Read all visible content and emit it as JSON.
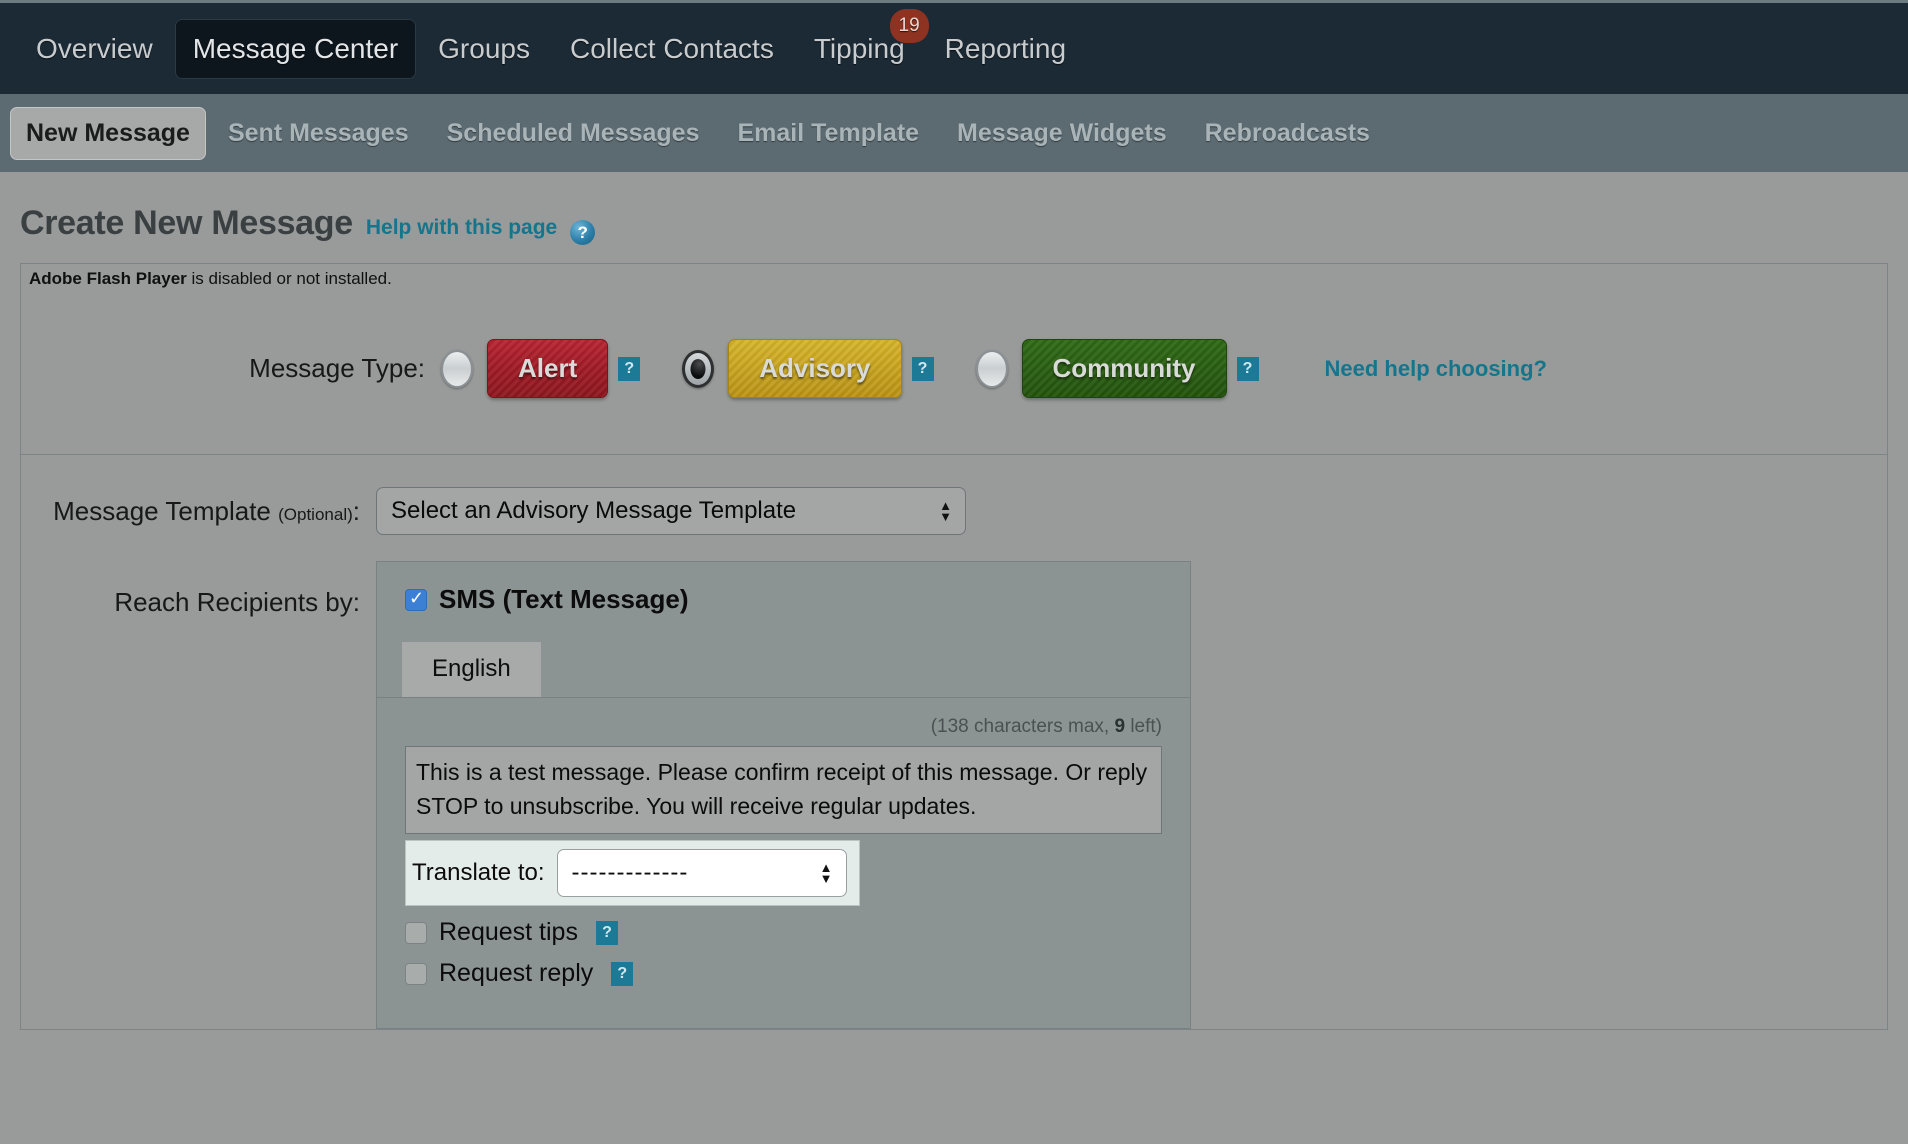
{
  "topnav": {
    "items": [
      {
        "label": "Overview",
        "active": false
      },
      {
        "label": "Message Center",
        "active": true
      },
      {
        "label": "Groups",
        "active": false
      },
      {
        "label": "Collect Contacts",
        "active": false
      },
      {
        "label": "Tipping",
        "active": false,
        "badge": "19"
      },
      {
        "label": "Reporting",
        "active": false
      }
    ]
  },
  "subnav": {
    "items": [
      {
        "label": "New Message",
        "active": true
      },
      {
        "label": "Sent Messages",
        "active": false
      },
      {
        "label": "Scheduled Messages",
        "active": false
      },
      {
        "label": "Email Template",
        "active": false
      },
      {
        "label": "Message Widgets",
        "active": false
      },
      {
        "label": "Rebroadcasts",
        "active": false
      }
    ]
  },
  "page": {
    "title": "Create New Message",
    "help_link": "Help with this page",
    "help_icon": "question-orb-icon",
    "flash_notice_bold": "Adobe Flash Player",
    "flash_notice_rest": " is disabled or not installed."
  },
  "message_type": {
    "label": "Message Type:",
    "options": [
      {
        "label": "Alert",
        "selected": false,
        "color": "#a01b26"
      },
      {
        "label": "Advisory",
        "selected": true,
        "color": "#c8a41f"
      },
      {
        "label": "Community",
        "selected": false,
        "color": "#2a5f13"
      }
    ],
    "help_glyph": "?",
    "need_help_link": "Need help choosing?"
  },
  "message_template": {
    "label": "Message Template",
    "optional_label": "(Optional)",
    "label_colon": ":",
    "selected_value": "Select an Advisory Message Template"
  },
  "reach_recipients": {
    "label": "Reach Recipients by:",
    "sms": {
      "checkbox_label": "SMS (Text Message)",
      "checked": true,
      "language_tabs": [
        {
          "label": "English",
          "active": true
        }
      ],
      "char_count_prefix": "(138 characters max, ",
      "char_count_left": "9",
      "char_count_suffix": " left)",
      "message_text": "This is a test message. Please confirm receipt of this message. Or reply STOP to unsubscribe. You will receive regular updates.",
      "translate_label": "Translate to:",
      "translate_value": "-------------",
      "options": [
        {
          "label": "Request tips",
          "checked": false
        },
        {
          "label": "Request reply",
          "checked": false
        }
      ]
    }
  },
  "colors": {
    "topnav_bg": "#1c2a35",
    "subnav_bg": "#5c6b71",
    "page_bg": "#989b9a",
    "link": "#15758d",
    "badge": "#8e3321",
    "checkbox_accent": "#3c80d6",
    "help_square": "#1d7a96"
  }
}
